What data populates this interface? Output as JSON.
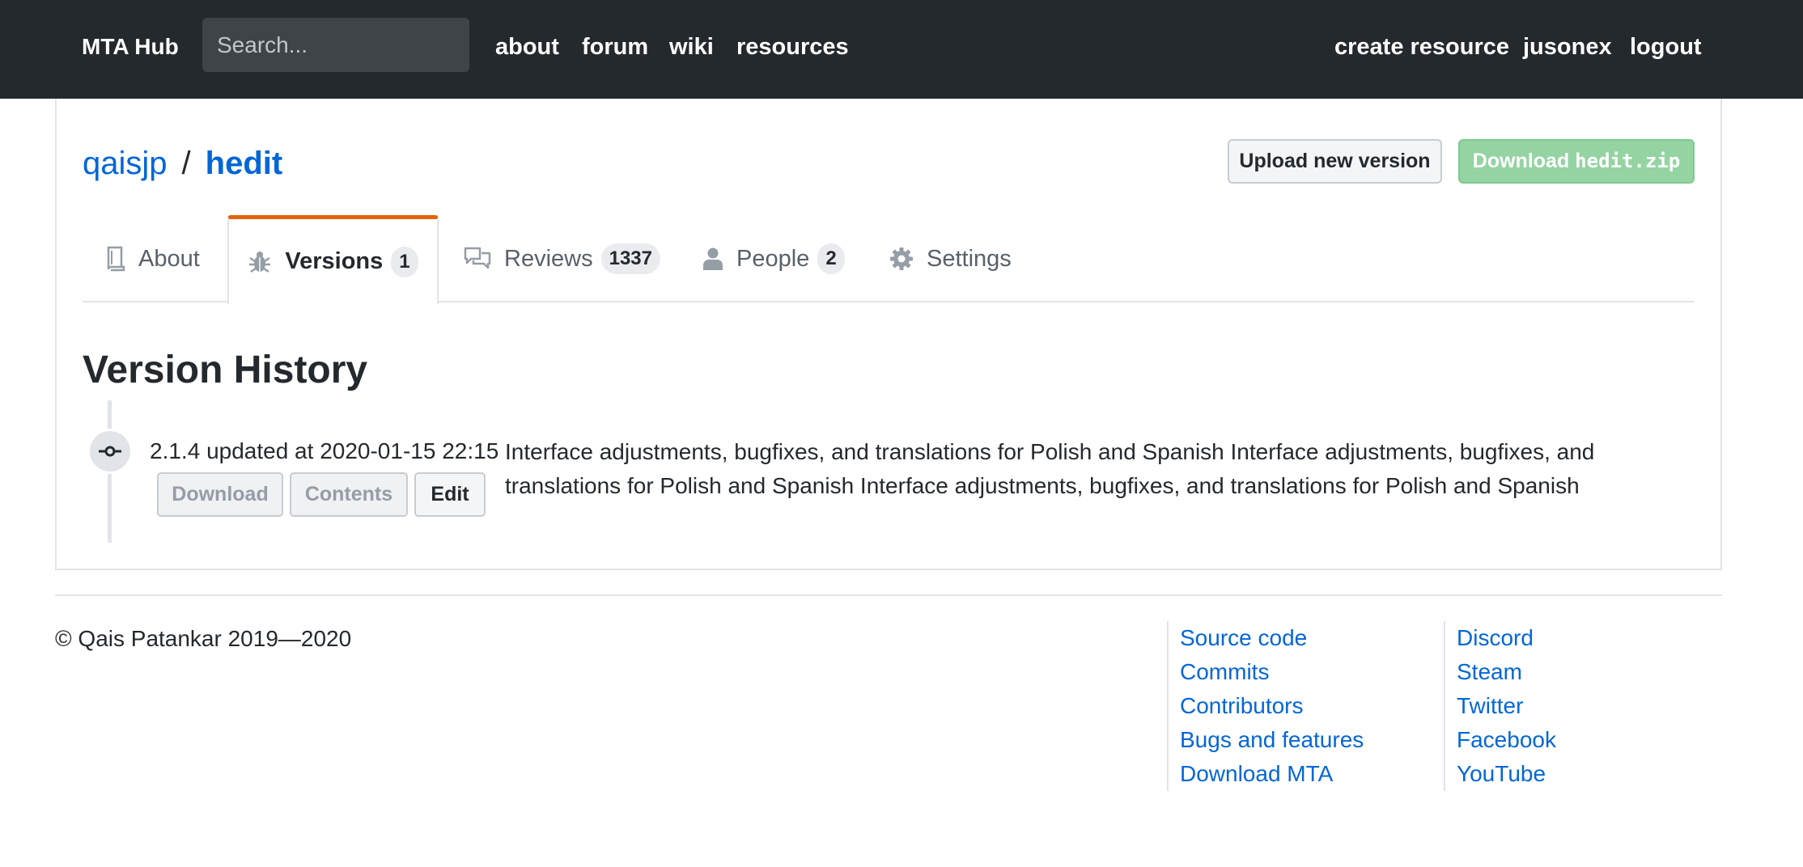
{
  "navbar": {
    "brand": "MTA Hub",
    "search_placeholder": "Search...",
    "links": [
      "about",
      "forum",
      "wiki",
      "resources"
    ],
    "right_links": [
      "create resource",
      "jusonex",
      "logout"
    ]
  },
  "resource": {
    "owner": "qaisjp",
    "separator": "/",
    "name": "hedit",
    "upload_label": "Upload new version",
    "download_prefix": "Download ",
    "download_file": "hedit.zip"
  },
  "tabs": [
    {
      "label": "About",
      "icon": "book-icon",
      "count": ""
    },
    {
      "label": "Versions",
      "icon": "bug-icon",
      "count": "1",
      "active": true
    },
    {
      "label": "Reviews",
      "icon": "comments-icon",
      "count": "1337"
    },
    {
      "label": "People",
      "icon": "person-icon",
      "count": "2"
    },
    {
      "label": "Settings",
      "icon": "gear-icon",
      "count": ""
    }
  ],
  "versions": {
    "title": "Version History",
    "items": [
      {
        "version": "2.1.4",
        "updated_text": "updated at",
        "timestamp": "2020-01-15 22:15",
        "notes": "Interface adjustments, bugfixes, and translations for Polish and Spanish Interface adjustments, bugfixes, and translations for Polish and Spanish Interface adjustments, bugfixes, and translations for Polish and Spanish",
        "buttons": {
          "download": "Download",
          "contents": "Contents",
          "edit": "Edit"
        }
      }
    ]
  },
  "footer": {
    "copyright": "© Qais Patankar 2019—2020",
    "col1": [
      "Source code",
      "Commits",
      "Contributors",
      "Bugs and features",
      "Download MTA"
    ],
    "col2": [
      "Discord",
      "Steam",
      "Twitter",
      "Facebook",
      "YouTube"
    ]
  },
  "colors": {
    "navbar_bg": "#24292e",
    "link": "#0366d6",
    "active_tab_accent": "#e36209",
    "download_button": "#94d3a2"
  }
}
